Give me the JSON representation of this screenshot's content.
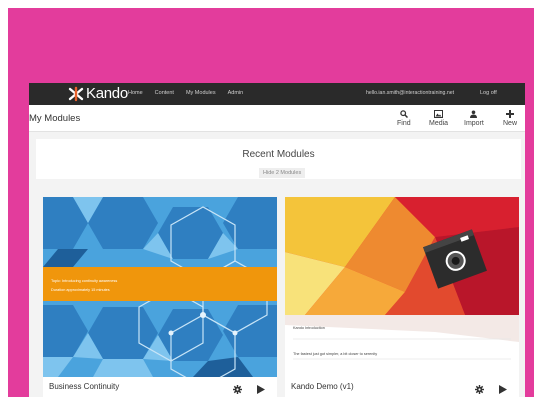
{
  "nav": {
    "logo_text": "Kando",
    "links": [
      "Home",
      "Content",
      "My Modules",
      "Admin"
    ],
    "user_email": "hello.ian.smith@interactiontraining.net",
    "logoff_label": "Log off"
  },
  "toolbar": {
    "page_title": "My Modules",
    "find_label": "Find",
    "media_label": "Media",
    "import_label": "Import",
    "new_label": "New"
  },
  "recent": {
    "title": "Recent Modules",
    "hide_label": "Hide 2 Modules"
  },
  "modules": [
    {
      "name": "Business Continuity",
      "banner_line1": "Topic: Introducing continuity awareness",
      "banner_line2": "Duration approximately 15 minutes"
    },
    {
      "name": "Kando Demo (v1)",
      "banner_line1": "Kando Introduction",
      "banner_line2": "The fastest just got simpler, a bit closer to serenity"
    }
  ],
  "colors": {
    "frame": "#e33c9c",
    "topnav": "#2a2a2a",
    "orange_band": "#f0960c"
  }
}
